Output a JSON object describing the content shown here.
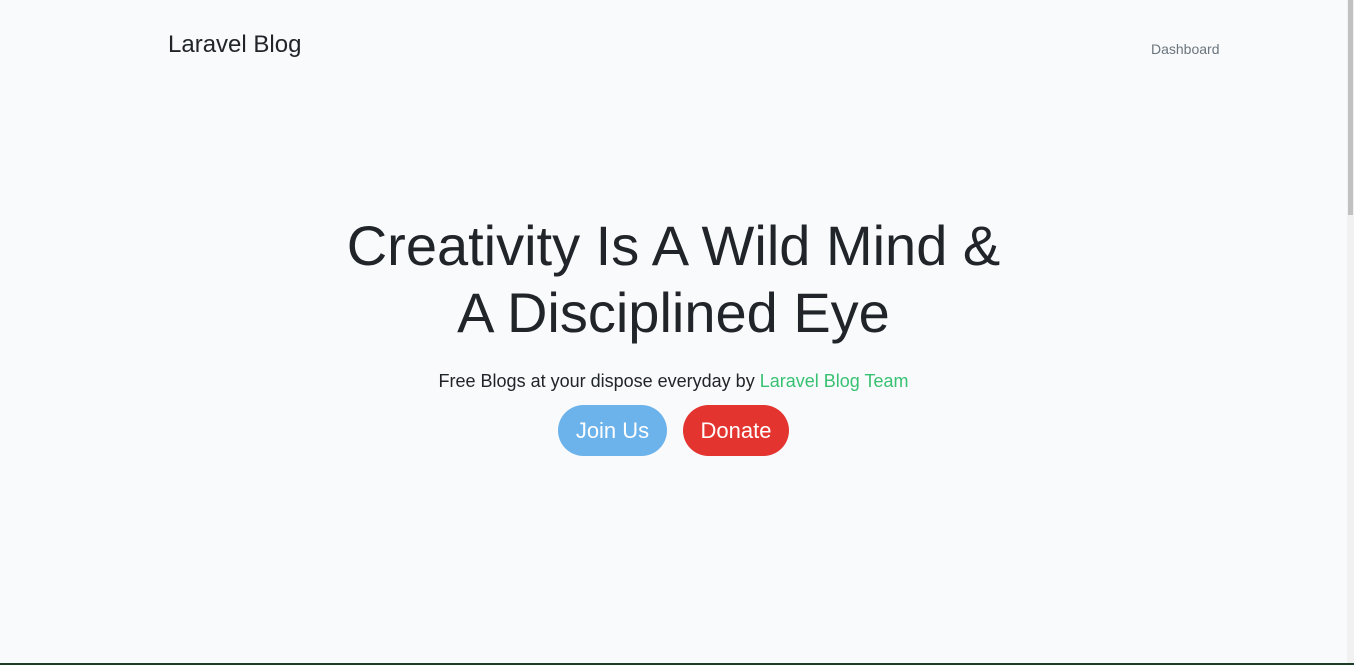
{
  "navbar": {
    "brand": "Laravel Blog",
    "links": [
      {
        "label": "Dashboard"
      }
    ]
  },
  "hero": {
    "title": "Creativity Is A Wild Mind & A Disciplined Eye",
    "subtitle_prefix": "Free Blogs at your dispose everyday by ",
    "subtitle_team": "Laravel Blog Team",
    "join_label": "Join Us",
    "donate_label": "Donate"
  },
  "colors": {
    "background": "#f8fafc",
    "text": "#212529",
    "team_link": "#38c172",
    "join_button": "#6cb2eb",
    "donate_button": "#e3342f",
    "nav_link": "#6c757d"
  }
}
